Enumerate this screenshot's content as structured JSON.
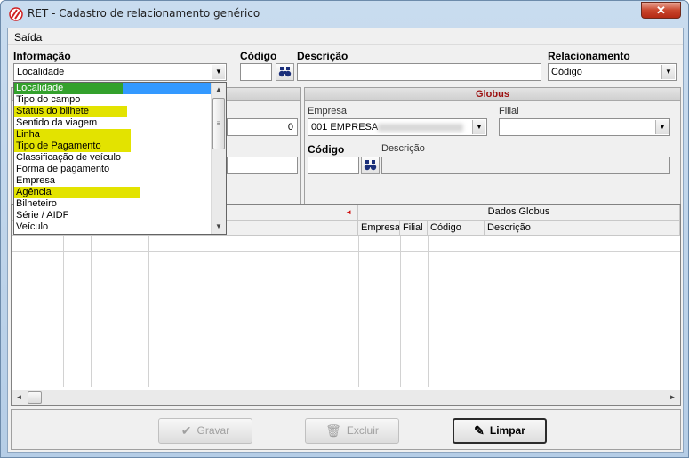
{
  "window": {
    "title": "RET - Cadastro de relacionamento genérico",
    "close_label": "✕"
  },
  "menu": {
    "items": [
      "Saída"
    ]
  },
  "form": {
    "informacao_label": "Informação",
    "informacao_value": "Localidade",
    "codigo_label": "Código",
    "codigo_value": "",
    "descricao_label": "Descrição",
    "descricao_value": "",
    "relacionamento_label": "Relacionamento",
    "relacionamento_value": "Código"
  },
  "left_panel": {
    "number_value": "0"
  },
  "globus": {
    "header": "Globus",
    "empresa_label": "Empresa",
    "empresa_value": "001 EMPRESA",
    "filial_label": "Filial",
    "filial_value": "",
    "codigo_label": "Código",
    "descricao_label": "Descrição"
  },
  "grid": {
    "group_left_marker": "◄",
    "group_right": "Dados Globus",
    "columns_right": [
      "Empresa",
      "Filial",
      "Código",
      "Descrição"
    ]
  },
  "dropdown": {
    "items": [
      {
        "label": "Localidade",
        "state": "selected"
      },
      {
        "label": "Tipo do campo",
        "state": ""
      },
      {
        "label": "Status do bilhete",
        "state": "highlight"
      },
      {
        "label": "Sentido da viagem",
        "state": ""
      },
      {
        "label": "Linha",
        "state": "highlight"
      },
      {
        "label": "Tipo de Pagamento",
        "state": "highlight"
      },
      {
        "label": "Classificação de veículo",
        "state": ""
      },
      {
        "label": "Forma de pagamento",
        "state": ""
      },
      {
        "label": "Empresa",
        "state": ""
      },
      {
        "label": "Agência",
        "state": "highlight"
      },
      {
        "label": "Bilheteiro",
        "state": ""
      },
      {
        "label": "Série / AIDF",
        "state": ""
      },
      {
        "label": "Veículo",
        "state": ""
      }
    ],
    "highlight_color": "#e3e300",
    "selected_color": "#33a12c"
  },
  "buttons": {
    "gravar": "Gravar",
    "excluir": "Excluir",
    "limpar": "Limpar"
  },
  "colors": {
    "panel_header_text": "#9b0e0e",
    "close_button": "#c9462c"
  }
}
